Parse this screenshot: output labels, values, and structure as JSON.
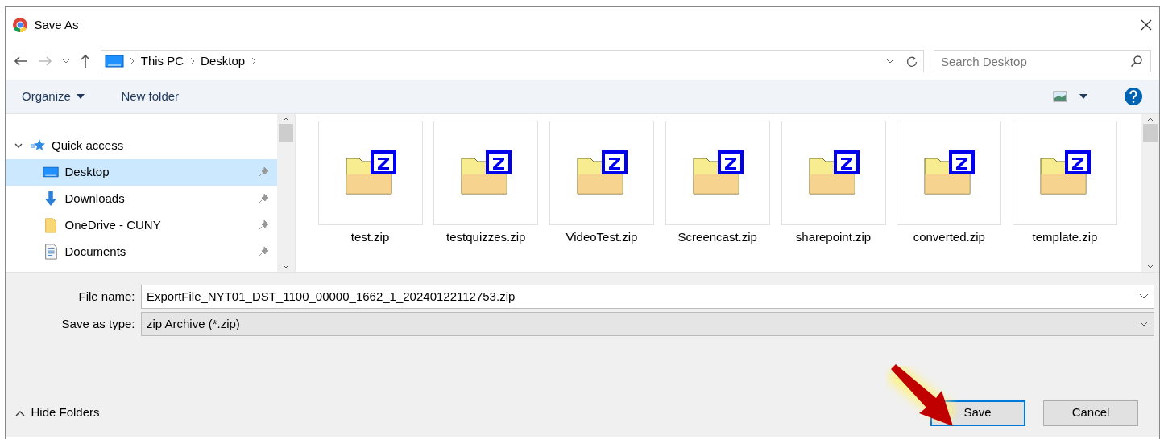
{
  "window": {
    "title": "Save As"
  },
  "address_bar": {
    "crumbs": [
      "This PC",
      "Desktop"
    ]
  },
  "search": {
    "placeholder": "Search Desktop"
  },
  "toolbar": {
    "organize": "Organize",
    "new_folder": "New folder"
  },
  "sidebar": {
    "items": [
      {
        "label": "Quick access",
        "kind": "star",
        "expanded": true,
        "selected": false,
        "children": [
          {
            "label": "Desktop",
            "kind": "desktop",
            "selected": true,
            "pinned": true
          },
          {
            "label": "Downloads",
            "kind": "download",
            "selected": false,
            "pinned": true
          },
          {
            "label": "OneDrive - CUNY",
            "kind": "folder",
            "selected": false,
            "pinned": true
          },
          {
            "label": "Documents",
            "kind": "document",
            "selected": false,
            "pinned": true
          }
        ]
      }
    ]
  },
  "files": [
    {
      "name": "test.zip"
    },
    {
      "name": "testquizzes.zip"
    },
    {
      "name": "VideoTest.zip"
    },
    {
      "name": "Screencast.zip"
    },
    {
      "name": "sharepoint.zip"
    },
    {
      "name": "converted.zip"
    },
    {
      "name": "template.zip"
    }
  ],
  "fields": [
    {
      "label": "File name:",
      "value": "ExportFile_NYT01_DST_1100_00000_1662_1_20240122112753.zip",
      "kind": "input"
    },
    {
      "label": "Save as type:",
      "value": "zip Archive (*.zip)",
      "kind": "select"
    }
  ],
  "hide_folders": "Hide Folders",
  "buttons": [
    {
      "label": "Save",
      "default": true
    },
    {
      "label": "Cancel",
      "default": false
    }
  ],
  "annotation": {
    "kind": "arrow"
  }
}
